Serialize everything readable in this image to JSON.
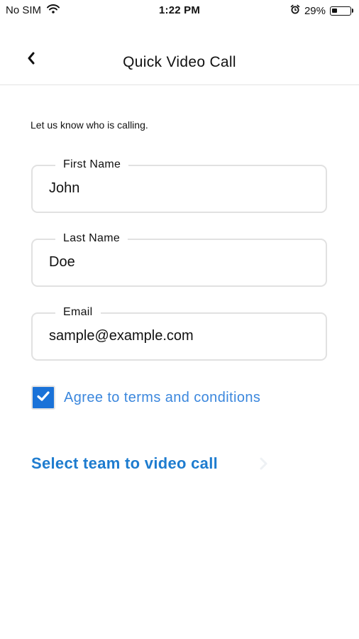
{
  "status_bar": {
    "carrier": "No SIM",
    "time": "1:22 PM",
    "battery_percent": "29%",
    "battery_level": 0.29,
    "icons": [
      "wifi-icon",
      "alarm-icon",
      "battery-icon"
    ]
  },
  "nav": {
    "title": "Quick Video Call",
    "back_icon": "chevron-left-icon"
  },
  "form": {
    "intro": "Let us know who is calling.",
    "first_name": {
      "label": "First Name",
      "value": "John"
    },
    "last_name": {
      "label": "Last Name",
      "value": "Doe"
    },
    "email": {
      "label": "Email",
      "value": "sample@example.com"
    },
    "agree": {
      "label": "Agree to terms and conditions",
      "checked": true
    }
  },
  "select_team": {
    "label": "Select team to video call",
    "icon": "chevron-right-icon"
  },
  "colors": {
    "accent": "#1a72d8",
    "link": "#1e7ccf",
    "agree_text": "#3b87dd",
    "border": "#e1e1e1"
  }
}
